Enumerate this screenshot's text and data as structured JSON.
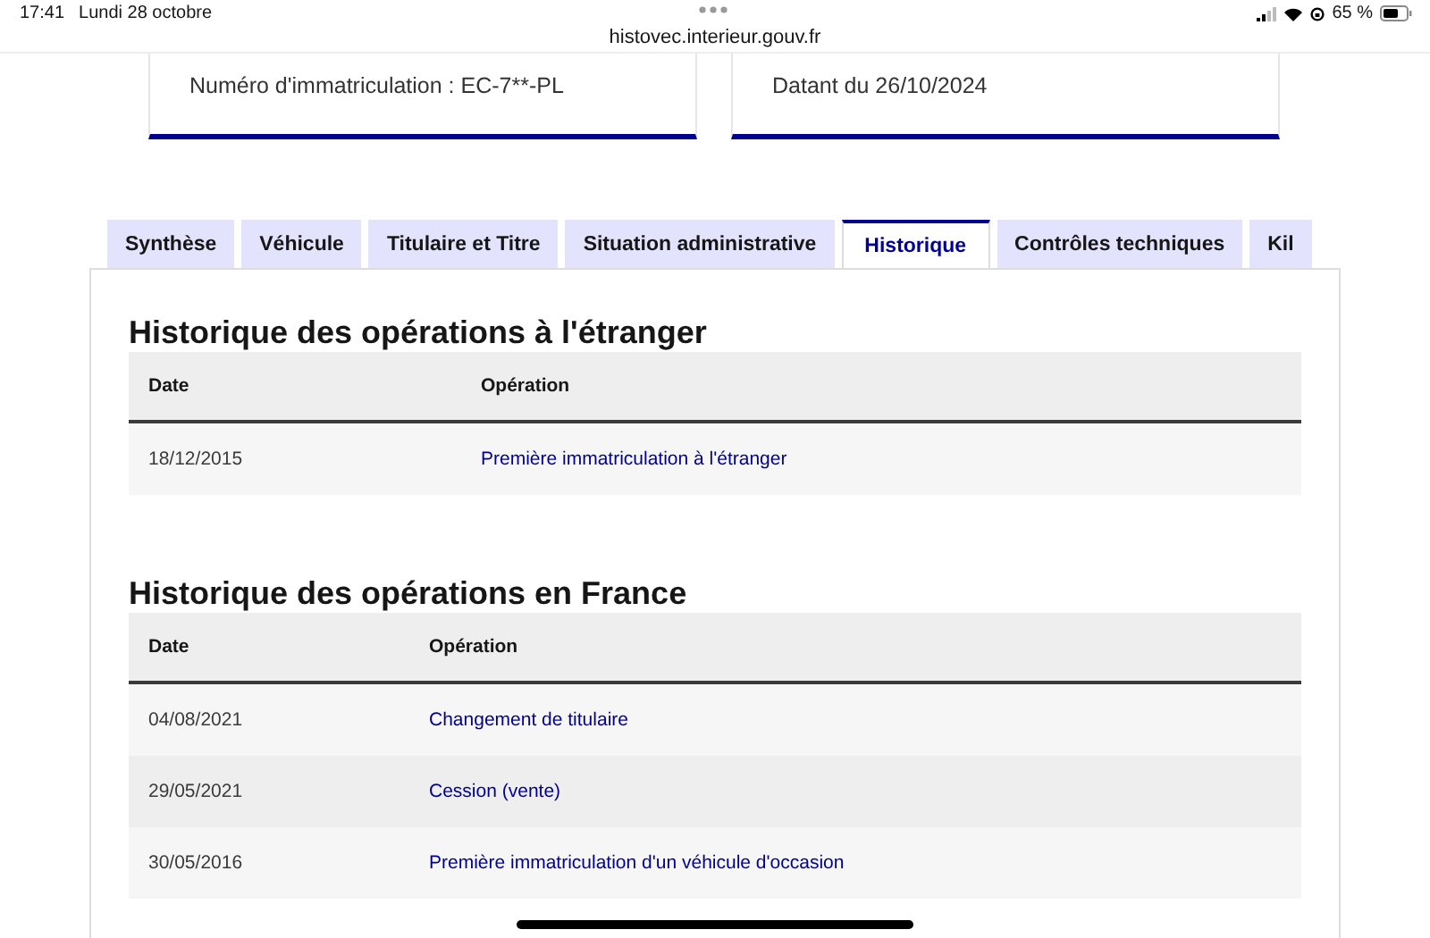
{
  "status_bar": {
    "time": "17:41",
    "date": "Lundi 28 octobre",
    "url": "histovec.interieur.gouv.fr",
    "battery": "65 %"
  },
  "cards": [
    {
      "text": "Numéro d'immatriculation : EC-7**-PL"
    },
    {
      "text": "Datant du 26/10/2024"
    }
  ],
  "tabs": [
    {
      "label": "Synthèse",
      "selected": false
    },
    {
      "label": "Véhicule",
      "selected": false
    },
    {
      "label": "Titulaire et Titre",
      "selected": false
    },
    {
      "label": "Situation administrative",
      "selected": false
    },
    {
      "label": "Historique",
      "selected": true
    },
    {
      "label": "Contrôles techniques",
      "selected": false
    },
    {
      "label": "Kil",
      "selected": false
    }
  ],
  "sections": [
    {
      "title": "Historique des opérations à l'étranger",
      "columns": [
        "Date",
        "Opération"
      ],
      "rows": [
        {
          "date": "18/12/2015",
          "operation": "Première immatriculation à l'étranger"
        }
      ]
    },
    {
      "title": "Historique des opérations en France",
      "columns": [
        "Date",
        "Opération"
      ],
      "rows": [
        {
          "date": "04/08/2021",
          "operation": "Changement de titulaire"
        },
        {
          "date": "29/05/2021",
          "operation": "Cession (vente)"
        },
        {
          "date": "30/05/2016",
          "operation": "Première immatriculation d'un véhicule d'occasion"
        }
      ]
    }
  ]
}
